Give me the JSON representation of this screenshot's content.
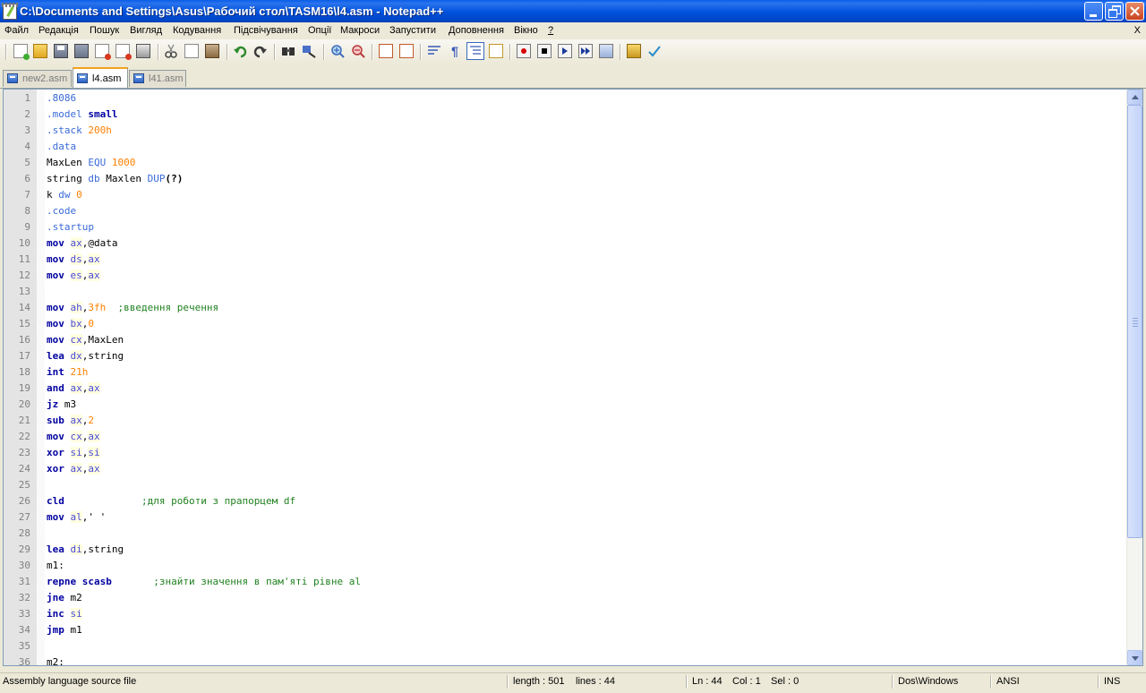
{
  "window": {
    "title": "C:\\Documents and Settings\\Asus\\Рабочий стол\\TASM16\\l4.asm - Notepad++"
  },
  "menu": {
    "items": [
      "Файл",
      "Редакція",
      "Пошук",
      "Вигляд",
      "Кодування",
      "Підсвічування",
      "Опції",
      "Макроси",
      "Запустити",
      "Доповнення",
      "Вікно",
      "?"
    ],
    "close_doc": "X"
  },
  "toolbar": {
    "icons": [
      "new-file-icon",
      "open-file-icon",
      "save-icon",
      "save-all-icon",
      "close-icon",
      "close-all-icon",
      "print-icon",
      "cut-icon",
      "copy-icon",
      "paste-icon",
      "undo-icon",
      "redo-icon",
      "find-icon",
      "replace-icon",
      "zoom-in-icon",
      "zoom-out-icon",
      "sync-vertical-icon",
      "sync-horizontal-icon",
      "word-wrap-icon",
      "show-all-chars-icon",
      "indent-guide-icon",
      "user-lang-icon",
      "record-macro-icon",
      "stop-record-icon",
      "playback-icon",
      "run-macro-multiple-icon",
      "save-macro-icon",
      "folder-icon",
      "spellcheck-icon"
    ]
  },
  "tabs": [
    {
      "label": "new2.asm",
      "active": false
    },
    {
      "label": "l4.asm",
      "active": true
    },
    {
      "label": "l41.asm",
      "active": false
    }
  ],
  "editor": {
    "lines": [
      [
        [
          "dir",
          ".8086"
        ]
      ],
      [
        [
          "dir",
          ".model "
        ],
        [
          "kw",
          "small"
        ]
      ],
      [
        [
          "dir",
          ".stack "
        ],
        [
          "num",
          "200h"
        ]
      ],
      [
        [
          "dir",
          ".data"
        ]
      ],
      [
        [
          "txt",
          "MaxLen "
        ],
        [
          "dir",
          "EQU "
        ],
        [
          "num",
          "1000"
        ]
      ],
      [
        [
          "txt",
          "string "
        ],
        [
          "dir",
          "db"
        ],
        [
          "txt",
          " Maxlen "
        ],
        [
          "dir",
          "DUP"
        ],
        [
          "bop",
          "(?)"
        ]
      ],
      [
        [
          "txt",
          "k "
        ],
        [
          "dir",
          "dw "
        ],
        [
          "num",
          "0"
        ]
      ],
      [
        [
          "dir",
          ".code"
        ]
      ],
      [
        [
          "dir",
          ".startup"
        ]
      ],
      [
        [
          "kw",
          "mov "
        ],
        [
          "reg",
          "ax"
        ],
        [
          "op",
          ",@data"
        ]
      ],
      [
        [
          "kw",
          "mov "
        ],
        [
          "reg",
          "ds"
        ],
        [
          "op",
          ","
        ],
        [
          "reg",
          "ax"
        ]
      ],
      [
        [
          "kw",
          "mov "
        ],
        [
          "reg",
          "es"
        ],
        [
          "op",
          ","
        ],
        [
          "reg",
          "ax"
        ]
      ],
      [],
      [
        [
          "kw",
          "mov "
        ],
        [
          "reg",
          "ah"
        ],
        [
          "op",
          ","
        ],
        [
          "num",
          "3fh"
        ],
        [
          "txt",
          "  "
        ],
        [
          "cmt",
          ";введення речення"
        ]
      ],
      [
        [
          "kw",
          "mov "
        ],
        [
          "reg",
          "bx"
        ],
        [
          "op",
          ","
        ],
        [
          "num",
          "0"
        ]
      ],
      [
        [
          "kw",
          "mov "
        ],
        [
          "reg",
          "cx"
        ],
        [
          "op",
          ",MaxLen"
        ]
      ],
      [
        [
          "kw",
          "lea "
        ],
        [
          "reg",
          "dx"
        ],
        [
          "op",
          ",string"
        ]
      ],
      [
        [
          "kw",
          "int "
        ],
        [
          "num",
          "21h"
        ]
      ],
      [
        [
          "kw",
          "and "
        ],
        [
          "reg",
          "ax"
        ],
        [
          "op",
          ","
        ],
        [
          "reg",
          "ax"
        ]
      ],
      [
        [
          "kw",
          "jz "
        ],
        [
          "txt",
          "m3"
        ]
      ],
      [
        [
          "kw",
          "sub "
        ],
        [
          "reg",
          "ax"
        ],
        [
          "op",
          ","
        ],
        [
          "num",
          "2"
        ]
      ],
      [
        [
          "kw",
          "mov "
        ],
        [
          "reg",
          "cx"
        ],
        [
          "op",
          ","
        ],
        [
          "reg",
          "ax"
        ]
      ],
      [
        [
          "kw",
          "xor "
        ],
        [
          "reg",
          "si"
        ],
        [
          "op",
          ","
        ],
        [
          "reg",
          "si"
        ]
      ],
      [
        [
          "kw",
          "xor "
        ],
        [
          "reg",
          "ax"
        ],
        [
          "op",
          ","
        ],
        [
          "reg",
          "ax"
        ]
      ],
      [],
      [
        [
          "kw",
          "cld"
        ],
        [
          "txt",
          "             "
        ],
        [
          "cmt",
          ";для роботи з прапорцем df"
        ]
      ],
      [
        [
          "kw",
          "mov "
        ],
        [
          "reg",
          "al"
        ],
        [
          "op",
          ",' '"
        ]
      ],
      [],
      [
        [
          "kw",
          "lea "
        ],
        [
          "reg",
          "di"
        ],
        [
          "op",
          ",string"
        ]
      ],
      [
        [
          "txt",
          "m1:"
        ]
      ],
      [
        [
          "kw",
          "repne scasb"
        ],
        [
          "txt",
          "       "
        ],
        [
          "cmt",
          ";знайти значення в пам'яті рівне al"
        ]
      ],
      [
        [
          "kw",
          "jne "
        ],
        [
          "txt",
          "m2"
        ]
      ],
      [
        [
          "kw",
          "inc "
        ],
        [
          "reg",
          "si"
        ]
      ],
      [
        [
          "kw",
          "jmp "
        ],
        [
          "txt",
          "m1"
        ]
      ],
      [],
      [
        [
          "txt",
          "m2:"
        ]
      ]
    ]
  },
  "status": {
    "file_type": "Assembly language source file",
    "length": "length : 501",
    "lines": "lines : 44",
    "ln": "Ln : 44",
    "col": "Col : 1",
    "sel": "Sel : 0",
    "eol": "Dos\\Windows",
    "encoding": "ANSI",
    "mode": "INS"
  }
}
